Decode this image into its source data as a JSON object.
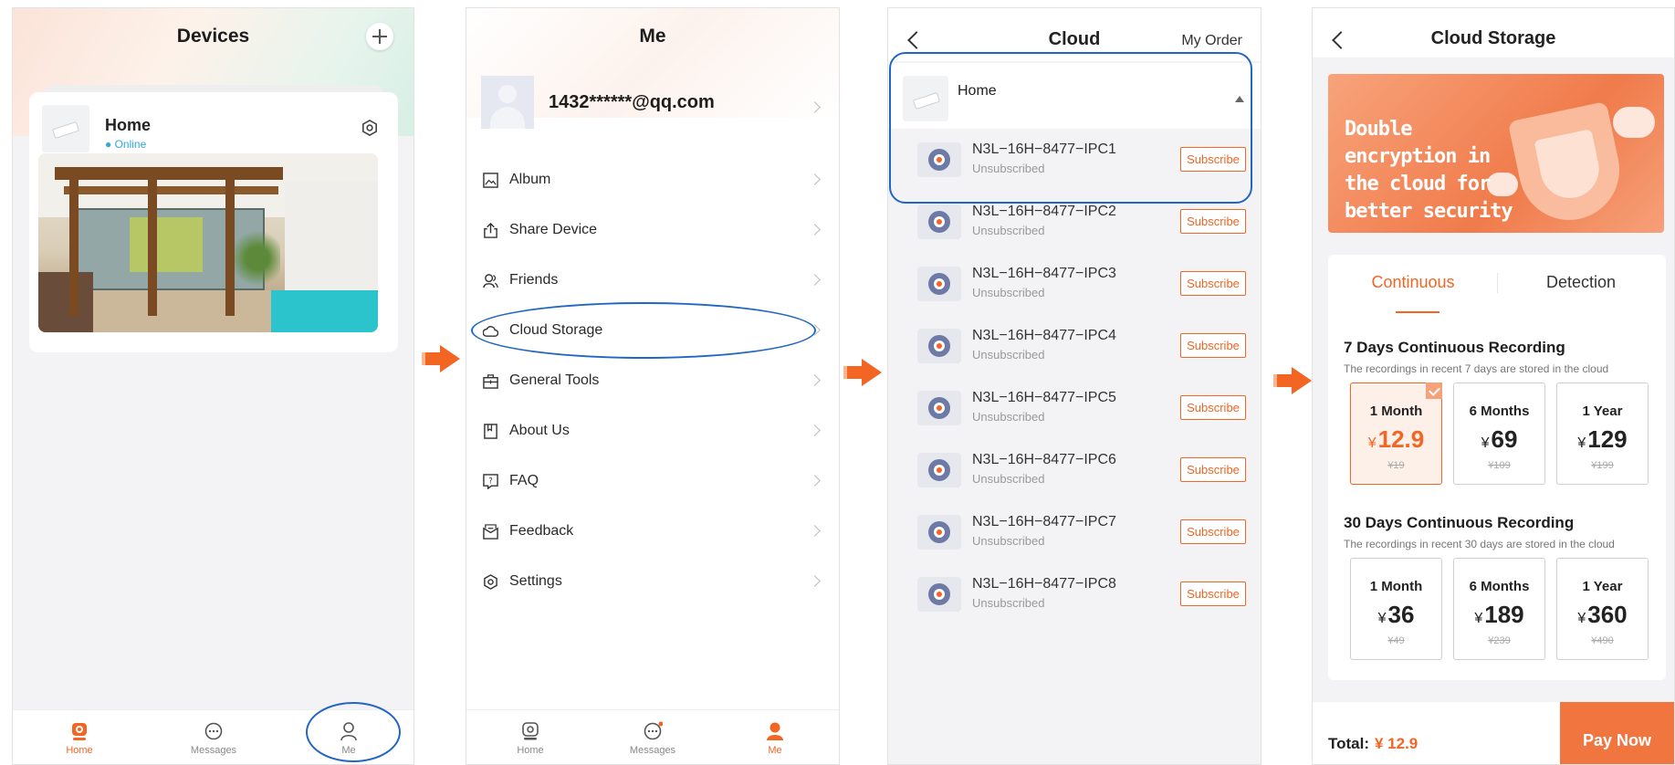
{
  "screen1": {
    "title": "Devices",
    "device": {
      "name": "Home",
      "status": "Online"
    },
    "tabs": [
      {
        "label": "Home"
      },
      {
        "label": "Messages"
      },
      {
        "label": "Me"
      }
    ]
  },
  "screen2": {
    "title": "Me",
    "account": "1432******@qq.com",
    "menu": [
      {
        "label": "Album",
        "icon": "album-icon"
      },
      {
        "label": "Share Device",
        "icon": "share-icon"
      },
      {
        "label": "Friends",
        "icon": "friends-icon"
      },
      {
        "label": "Cloud Storage",
        "icon": "cloud-icon"
      },
      {
        "label": "General Tools",
        "icon": "toolbox-icon"
      },
      {
        "label": "About Us",
        "icon": "bookmark-icon"
      },
      {
        "label": "FAQ",
        "icon": "faq-icon"
      },
      {
        "label": "Feedback",
        "icon": "feedback-icon"
      },
      {
        "label": "Settings",
        "icon": "settings-icon"
      }
    ],
    "tabs": [
      {
        "label": "Home"
      },
      {
        "label": "Messages"
      },
      {
        "label": "Me"
      }
    ]
  },
  "screen3": {
    "title": "Cloud",
    "my_order": "My Order",
    "group": "Home",
    "cameras": [
      {
        "name": "N3L−16H−8477−IPC1",
        "status": "Unsubscribed",
        "action": "Subscribe"
      },
      {
        "name": "N3L−16H−8477−IPC2",
        "status": "Unsubscribed",
        "action": "Subscribe"
      },
      {
        "name": "N3L−16H−8477−IPC3",
        "status": "Unsubscribed",
        "action": "Subscribe"
      },
      {
        "name": "N3L−16H−8477−IPC4",
        "status": "Unsubscribed",
        "action": "Subscribe"
      },
      {
        "name": "N3L−16H−8477−IPC5",
        "status": "Unsubscribed",
        "action": "Subscribe"
      },
      {
        "name": "N3L−16H−8477−IPC6",
        "status": "Unsubscribed",
        "action": "Subscribe"
      },
      {
        "name": "N3L−16H−8477−IPC7",
        "status": "Unsubscribed",
        "action": "Subscribe"
      },
      {
        "name": "N3L−16H−8477−IPC8",
        "status": "Unsubscribed",
        "action": "Subscribe"
      }
    ]
  },
  "screen4": {
    "title": "Cloud Storage",
    "banner": "Double encryption in the cloud for better security",
    "tabs": [
      "Continuous",
      "Detection"
    ],
    "section7": {
      "title": "7 Days Continuous Recording",
      "desc": "The recordings in recent 7 days are stored in the cloud",
      "plans": [
        {
          "period": "1 Month",
          "currency": "¥",
          "price": "12.9",
          "old": "¥19",
          "selected": true
        },
        {
          "period": "6 Months",
          "currency": "¥",
          "price": "69",
          "old": "¥109",
          "selected": false
        },
        {
          "period": "1 Year",
          "currency": "¥",
          "price": "129",
          "old": "¥199",
          "selected": false
        }
      ]
    },
    "section30": {
      "title": "30 Days Continuous Recording",
      "desc": "The recordings in recent 30 days are stored in the cloud",
      "plans": [
        {
          "period": "1 Month",
          "currency": "¥",
          "price": "36",
          "old": "¥49",
          "selected": false
        },
        {
          "period": "6 Months",
          "currency": "¥",
          "price": "189",
          "old": "¥239",
          "selected": false
        },
        {
          "period": "1 Year",
          "currency": "¥",
          "price": "360",
          "old": "¥490",
          "selected": false
        }
      ]
    },
    "total_label": "Total:",
    "total_value": "¥ 12.9",
    "pay_button": "Pay Now"
  },
  "colors": {
    "accent": "#f26522",
    "highlight": "#2266c4"
  }
}
